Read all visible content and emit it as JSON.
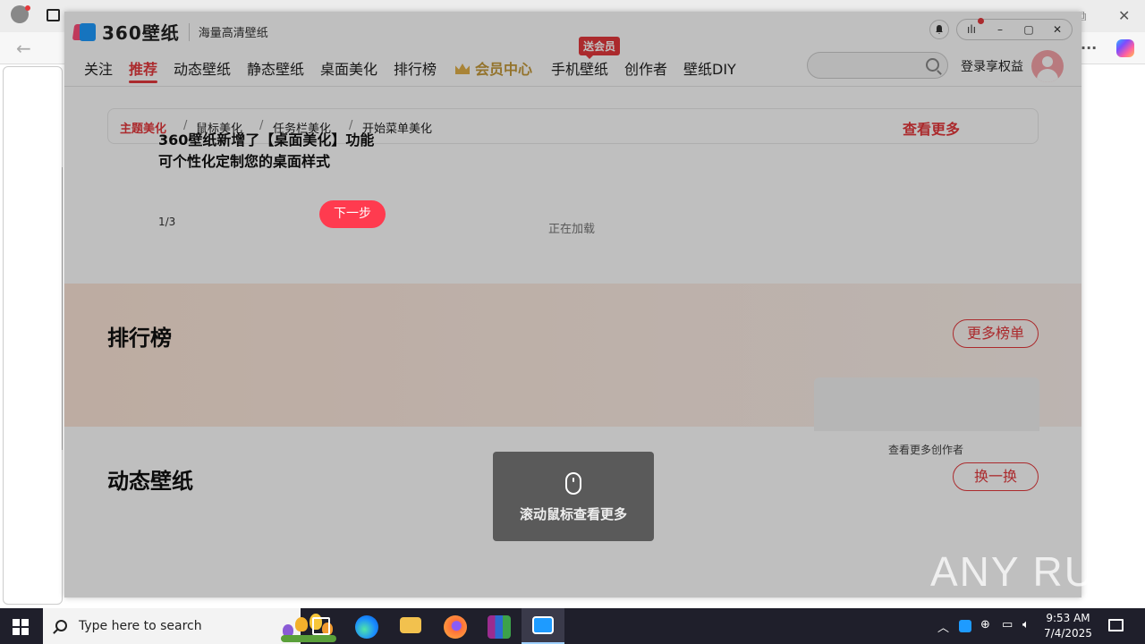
{
  "browser": {
    "more_label": "···",
    "close_label": "✕",
    "restore_label": "⧉"
  },
  "app": {
    "logo_text": "360壁纸",
    "slogan": "海量高清壁纸",
    "window_controls": {
      "bell": "bell-icon",
      "menu": "ılı",
      "minimize": "–",
      "maximize": "▢",
      "close": "✕"
    },
    "nav": {
      "items": [
        "关注",
        "推荐",
        "动态壁纸",
        "静态壁纸",
        "桌面美化",
        "排行榜",
        "会员中心",
        "手机壁纸",
        "创作者",
        "壁纸DIY"
      ],
      "active_index": 1,
      "badge": "送会员"
    },
    "search": {
      "placeholder": ""
    },
    "login_label": "登录享权益",
    "breadcrumb": {
      "items": [
        "主题美化",
        "鼠标美化",
        "任务栏美化",
        "开始菜单美化"
      ],
      "separator": "/",
      "more_label": "查看更多"
    },
    "guide": {
      "title_line1": "360壁纸新增了【桌面美化】功能",
      "title_line2": "可个性化定制您的桌面样式",
      "step": "1/3",
      "next_label": "下一步"
    },
    "loading_text": "正在加载",
    "ranking": {
      "title": "排行榜",
      "more_label": "更多榜单"
    },
    "creator_more": "查看更多创作者",
    "dynamic": {
      "title": "动态壁纸",
      "refresh_label": "换一换"
    },
    "toast": {
      "text": "滚动鼠标查看更多"
    },
    "accent_color": "#e4393c"
  },
  "watermark": {
    "text": "ANY RUN"
  },
  "taskbar": {
    "search_placeholder": "Type here to search",
    "time": "9:53 AM",
    "date": "7/4/2025"
  }
}
